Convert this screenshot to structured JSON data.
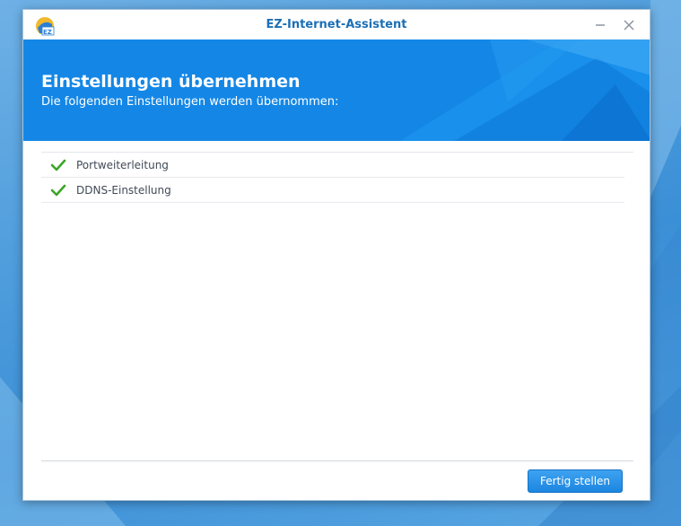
{
  "window": {
    "title": "EZ-Internet-Assistent",
    "app_icon": "ez-internet-app-icon",
    "controls": {
      "minimize": "minimize-icon",
      "close": "close-icon"
    }
  },
  "banner": {
    "title": "Einstellungen übernehmen",
    "subtitle": "Die folgenden Einstellungen werden übernommen:"
  },
  "settings": {
    "items": [
      {
        "label": "Portweiterleitung",
        "icon": "check-icon",
        "status": "done"
      },
      {
        "label": "DDNS-Einstellung",
        "icon": "check-icon",
        "status": "done"
      }
    ]
  },
  "footer": {
    "finish_label": "Fertig stellen"
  },
  "colors": {
    "accent": "#1487e6",
    "title_text": "#1b6fb5",
    "check": "#3aa526",
    "button": "#2590e6"
  }
}
